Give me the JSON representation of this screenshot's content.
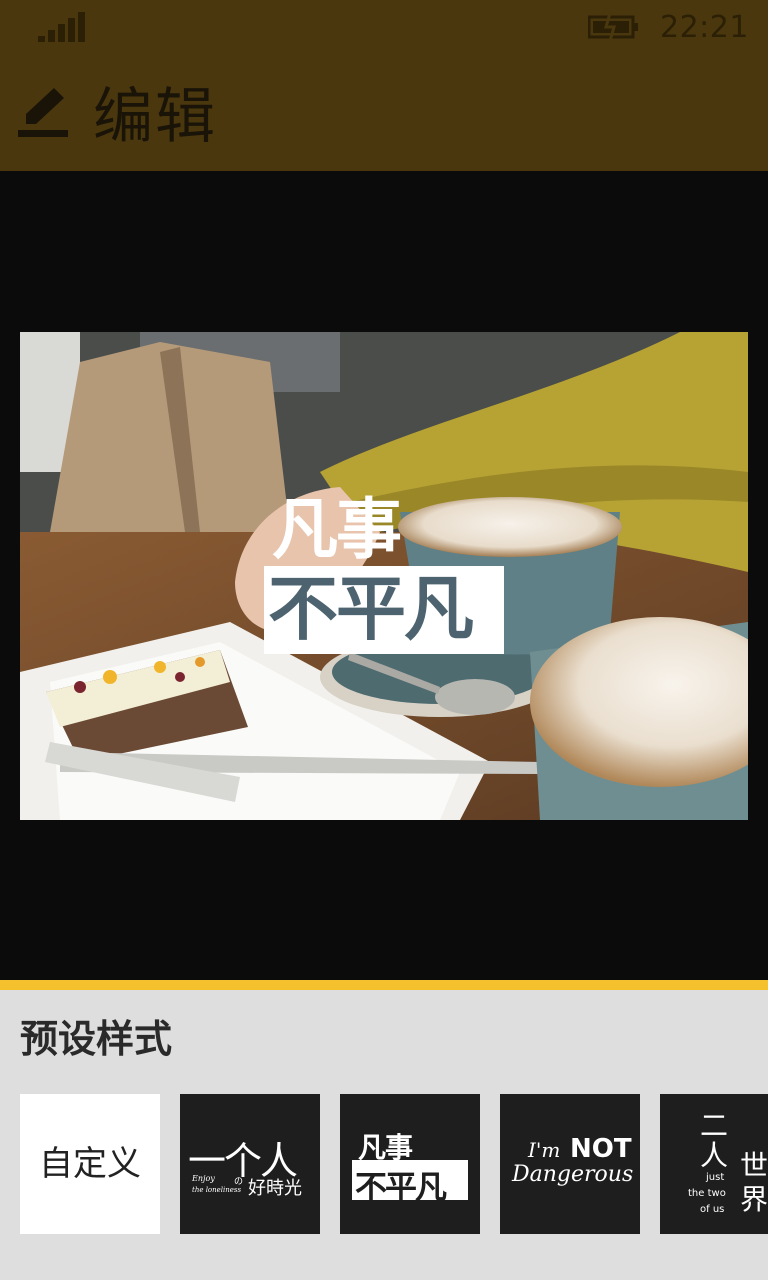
{
  "status_bar": {
    "time": "22:21",
    "signal_icon": "signal-strength-icon",
    "battery_icon": "battery-charging-icon"
  },
  "header": {
    "title": "编辑",
    "icon": "edit-pencil-icon"
  },
  "canvas": {
    "overlay_line1": "凡事",
    "overlay_line2": "不平凡"
  },
  "presets_panel": {
    "title": "预设样式",
    "items": [
      {
        "label": "自定义"
      },
      {
        "main": "一个人",
        "sub_en1": "Enjoy",
        "sub_en2": "the loneliness",
        "sub_no": "の",
        "sub_cn": "好時光"
      },
      {
        "line1": "凡事",
        "line2": "不平凡"
      },
      {
        "line1_a": "I'm",
        "line1_b": "NOT",
        "line2": "Dangerous"
      },
      {
        "col_a1": "二",
        "col_a2": "人",
        "en1": "just",
        "en2": "the two",
        "en3": "of us",
        "col_b1": "世",
        "col_b2": "界"
      }
    ]
  },
  "colors": {
    "header_bg": "#4a370d",
    "accent": "#f5c22e",
    "panel_bg": "#dedede"
  }
}
